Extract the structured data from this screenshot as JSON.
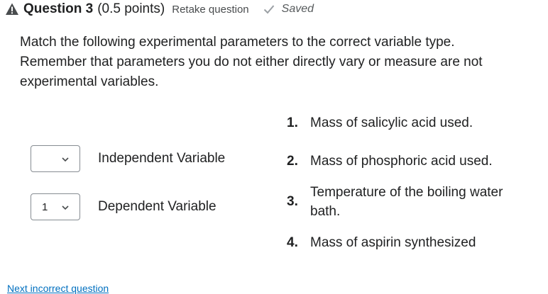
{
  "question": {
    "title": "Question 3",
    "points": "(0.5 points)",
    "retake_label": "Retake question",
    "saved_label": "Saved"
  },
  "prompt": {
    "line1": "Match the following experimental parameters to the correct variable type.",
    "line2": "Remember that parameters you do not either directly vary or measure are not experimental variables."
  },
  "matches": [
    {
      "selected": "",
      "label": "Independent Variable"
    },
    {
      "selected": "1",
      "label": "Dependent Variable"
    }
  ],
  "choices": [
    {
      "num": "1.",
      "text": "Mass of salicylic acid used."
    },
    {
      "num": "2.",
      "text": "Mass of phosphoric acid used."
    },
    {
      "num": "3.",
      "text": "Temperature of the boiling water bath."
    },
    {
      "num": "4.",
      "text": "Mass of aspirin synthesized"
    }
  ],
  "next_link": "Next incorrect question",
  "icons": {
    "warning": "warning-triangle-icon",
    "saved": "checkmark-icon",
    "dropdown": "chevron-down-icon"
  },
  "colors": {
    "text": "#202122",
    "muted": "#565a5c",
    "border": "#868c92",
    "link": "#006fbf",
    "check": "#9ba0a5"
  }
}
